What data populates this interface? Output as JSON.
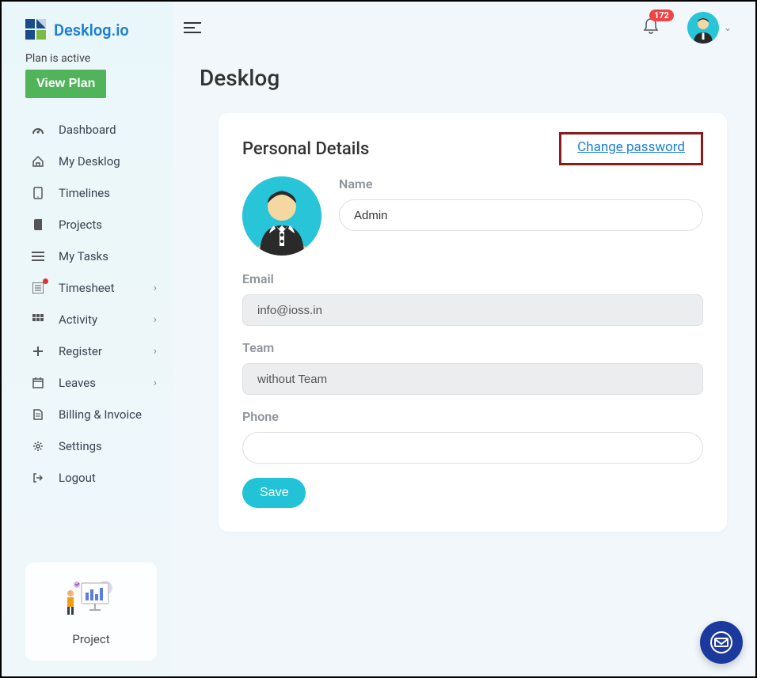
{
  "brand": {
    "name": "Desklog.io"
  },
  "plan": {
    "status": "Plan is active",
    "view_label": "View Plan"
  },
  "sidebar": {
    "items": [
      {
        "label": "Dashboard",
        "icon": "dashboard",
        "expandable": false
      },
      {
        "label": "My Desklog",
        "icon": "home",
        "expandable": false
      },
      {
        "label": "Timelines",
        "icon": "mobile",
        "expandable": false
      },
      {
        "label": "Projects",
        "icon": "book",
        "expandable": false
      },
      {
        "label": "My Tasks",
        "icon": "tasks",
        "expandable": false
      },
      {
        "label": "Timesheet",
        "icon": "list",
        "expandable": true,
        "has_dot": true
      },
      {
        "label": "Activity",
        "icon": "grid",
        "expandable": true
      },
      {
        "label": "Register",
        "icon": "plus",
        "expandable": true
      },
      {
        "label": "Leaves",
        "icon": "calendar",
        "expandable": true
      },
      {
        "label": "Billing & Invoice",
        "icon": "file",
        "expandable": false
      },
      {
        "label": "Settings",
        "icon": "gear",
        "expandable": false
      },
      {
        "label": "Logout",
        "icon": "logout",
        "expandable": false
      }
    ],
    "project_card_label": "Project"
  },
  "header": {
    "notification_count": "172"
  },
  "page": {
    "title": "Desklog",
    "card_title": "Personal Details",
    "change_password_label": "Change password",
    "fields": {
      "name_label": "Name",
      "name_value": "Admin",
      "email_label": "Email",
      "email_value": "info@ioss.in",
      "team_label": "Team",
      "team_value": "without Team",
      "phone_label": "Phone",
      "phone_value": ""
    },
    "save_label": "Save"
  }
}
